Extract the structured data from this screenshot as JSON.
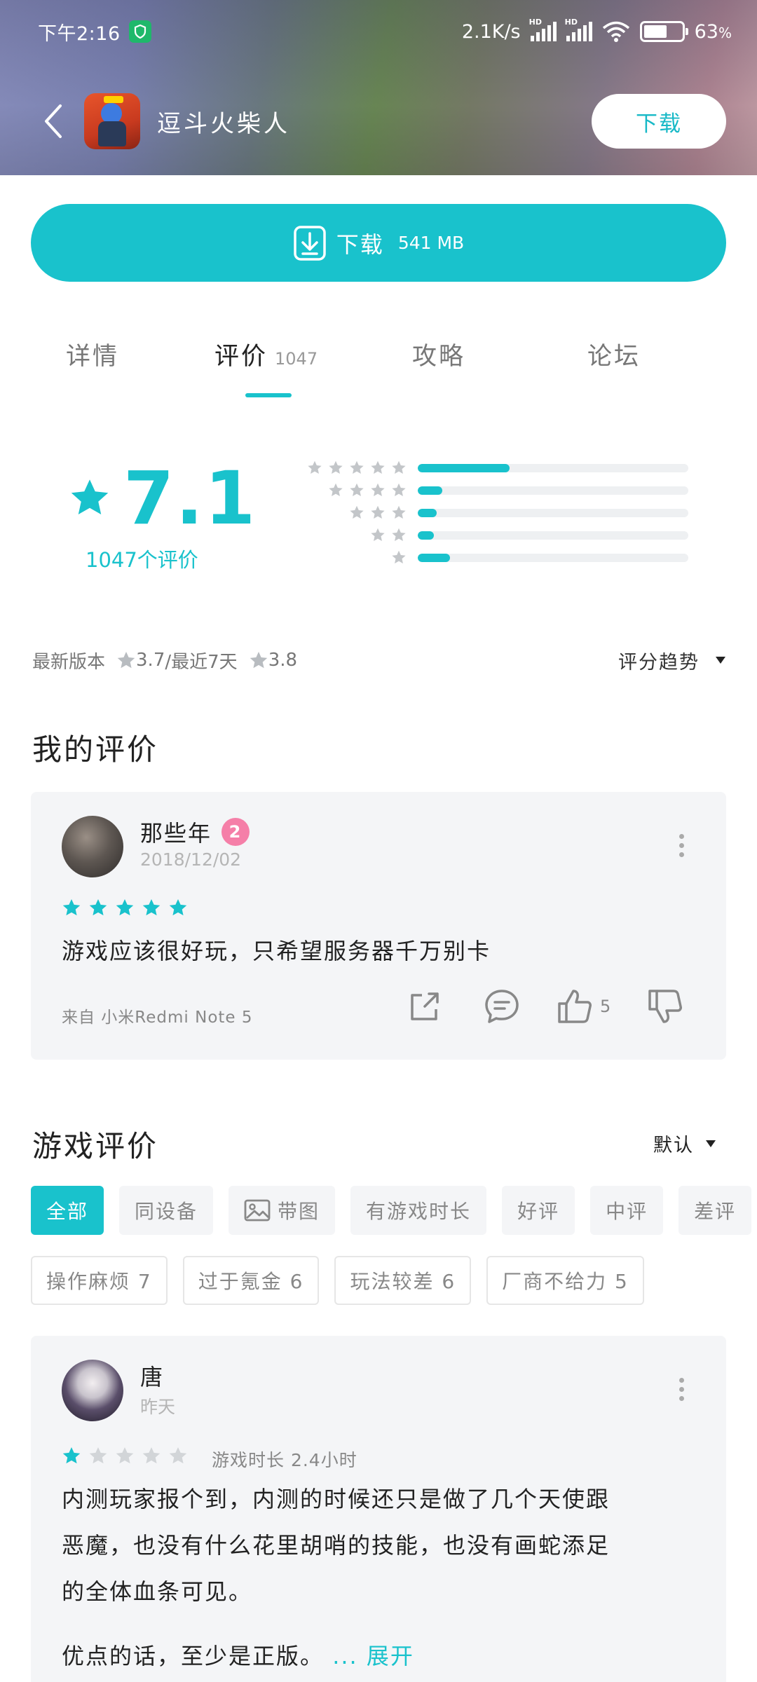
{
  "status_bar": {
    "time": "下午2:16",
    "net_speed": "2.1K/s",
    "battery": "63",
    "battery_unit": "%",
    "battery_level": 0.63
  },
  "header": {
    "app_name": "逗斗火柴人",
    "download_button": "下载"
  },
  "download_bar": {
    "label": "下载",
    "size": "541 MB"
  },
  "tabs": [
    {
      "label": "详情",
      "count": ""
    },
    {
      "label": "评价",
      "count": "1047"
    },
    {
      "label": "攻略",
      "count": ""
    },
    {
      "label": "论坛",
      "count": ""
    }
  ],
  "rating": {
    "score": "7.1",
    "count_text": "1047个评价",
    "distribution": [
      {
        "stars": 5,
        "fraction": 0.34
      },
      {
        "stars": 4,
        "fraction": 0.09
      },
      {
        "stars": 3,
        "fraction": 0.07
      },
      {
        "stars": 2,
        "fraction": 0.06
      },
      {
        "stars": 1,
        "fraction": 0.12
      }
    ]
  },
  "version_line": {
    "latest_label": "最新版本",
    "latest_score": "3.7",
    "recent_label": "/最近7天",
    "recent_score": "3.8",
    "trend_label": "评分趋势"
  },
  "my_review": {
    "section_title": "我的评价",
    "user": "那些年",
    "level": "2",
    "date": "2018/12/02",
    "stars": 5,
    "text": "游戏应该很好玩，只希望服务器千万别卡",
    "device": "来自 小米Redmi Note 5",
    "likes": "5"
  },
  "game_reviews": {
    "section_title": "游戏评价",
    "sort_label": "默认",
    "filters": [
      "全部",
      "同设备",
      "带图",
      "有游戏时长",
      "好评",
      "中评",
      "差评"
    ],
    "tags": [
      "操作麻烦 7",
      "过于氪金 6",
      "玩法较差 6",
      "厂商不给力 5"
    ]
  },
  "review": {
    "user": "唐",
    "date": "昨天",
    "stars": 1,
    "playtime": "游戏时长 2.4小时",
    "text_lines": [
      "内测玩家报个到，内测的时候还只是做了几个天使跟",
      "恶魔，也没有什么花里胡哨的技能，也没有画蛇添足",
      "的全体血条可见。"
    ],
    "text_last": "优点的话，至少是正版。",
    "expand": "... 展开"
  },
  "colors": {
    "accent": "#19c2cc",
    "level_badge": "#f57fa8",
    "shield": "#1fb86b"
  }
}
